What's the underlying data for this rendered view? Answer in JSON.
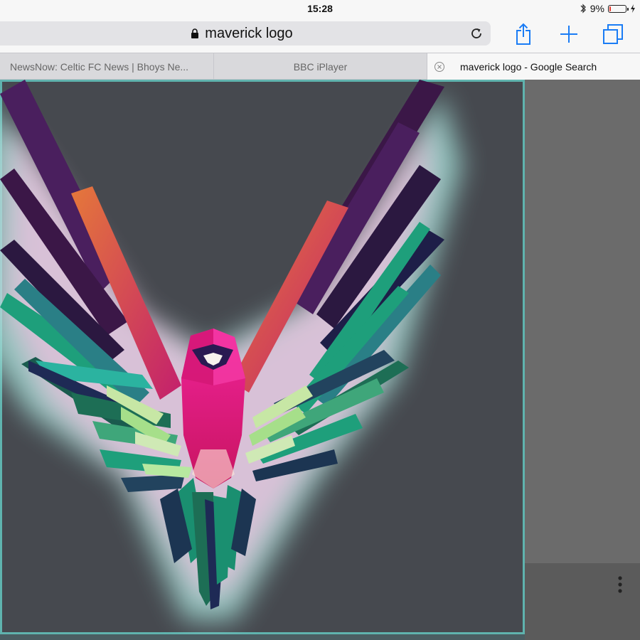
{
  "status": {
    "time": "15:28",
    "battery_text": "9%",
    "battery_level": 0.09
  },
  "toolbar": {
    "url_text": "maverick logo",
    "icons": [
      "lock-icon",
      "reload-icon",
      "share-icon",
      "add-tab-icon",
      "tabs-icon"
    ]
  },
  "tabs": [
    {
      "label": "NewsNow: Celtic FC News | Bhoys Ne...",
      "active": false
    },
    {
      "label": "BBC iPlayer",
      "active": false
    },
    {
      "label": "maverick logo - Google Search",
      "active": true
    }
  ],
  "colors": {
    "accent": "#1a7cf5",
    "panel_bg": "#46494f",
    "glow": "#7fd6cf",
    "body_pink": "#e8197d",
    "teal": "#1e9f7b",
    "purple": "#4a1f5e",
    "battery_low": "#e8392c"
  }
}
